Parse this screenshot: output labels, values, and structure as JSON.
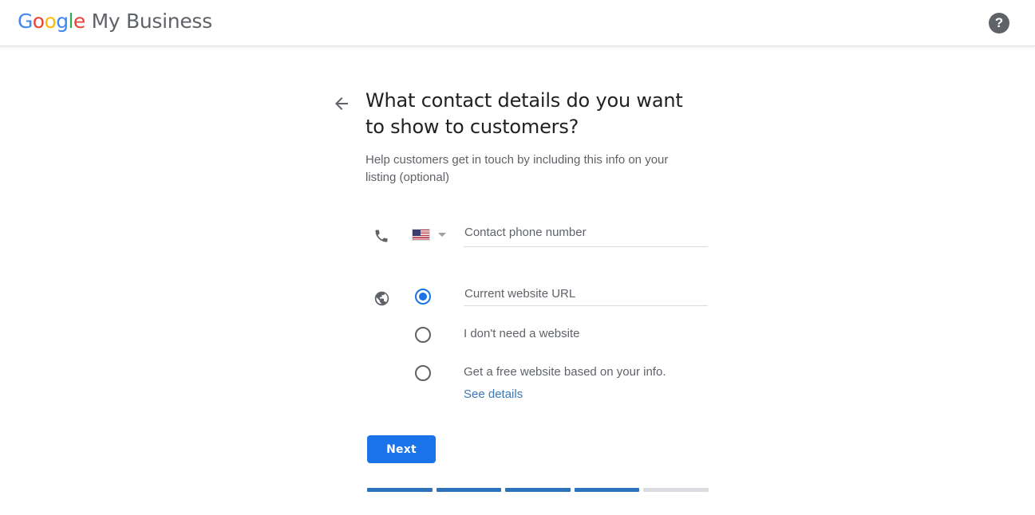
{
  "header": {
    "logo_google": "Google",
    "logo_letters": [
      "G",
      "o",
      "o",
      "g",
      "l",
      "e"
    ],
    "logo_suffix": "My Business",
    "help_icon": "help-question-mark-icon",
    "help_glyph": "?"
  },
  "main": {
    "back_icon": "back-arrow-icon",
    "heading": "What contact details do you want to show to customers?",
    "subheading": "Help customers get in touch by including this info on your listing (optional)",
    "phone": {
      "icon": "phone-icon",
      "country_flag": "us-flag-icon",
      "country_caret": "chevron-down-icon",
      "placeholder": "Contact phone number",
      "value": ""
    },
    "website": {
      "icon": "globe-icon",
      "options": [
        {
          "type": "input",
          "label": "",
          "placeholder": "Current website URL",
          "value": "",
          "selected": true
        },
        {
          "type": "label",
          "label": "I don't need a website",
          "selected": false
        },
        {
          "type": "label",
          "label": "Get a free website based on your info.",
          "selected": false,
          "link": "See details"
        }
      ]
    },
    "next_label": "Next",
    "progress": {
      "total": 5,
      "completed": 4,
      "segments": [
        "done",
        "done",
        "done",
        "done",
        "todo"
      ]
    }
  },
  "colors": {
    "accent_blue": "#1a73e8",
    "progress_blue": "#2c72bd",
    "progress_gray": "#dadce0",
    "link_blue": "#3c78b4",
    "text_primary": "#202124",
    "text_secondary": "#5f6368"
  }
}
